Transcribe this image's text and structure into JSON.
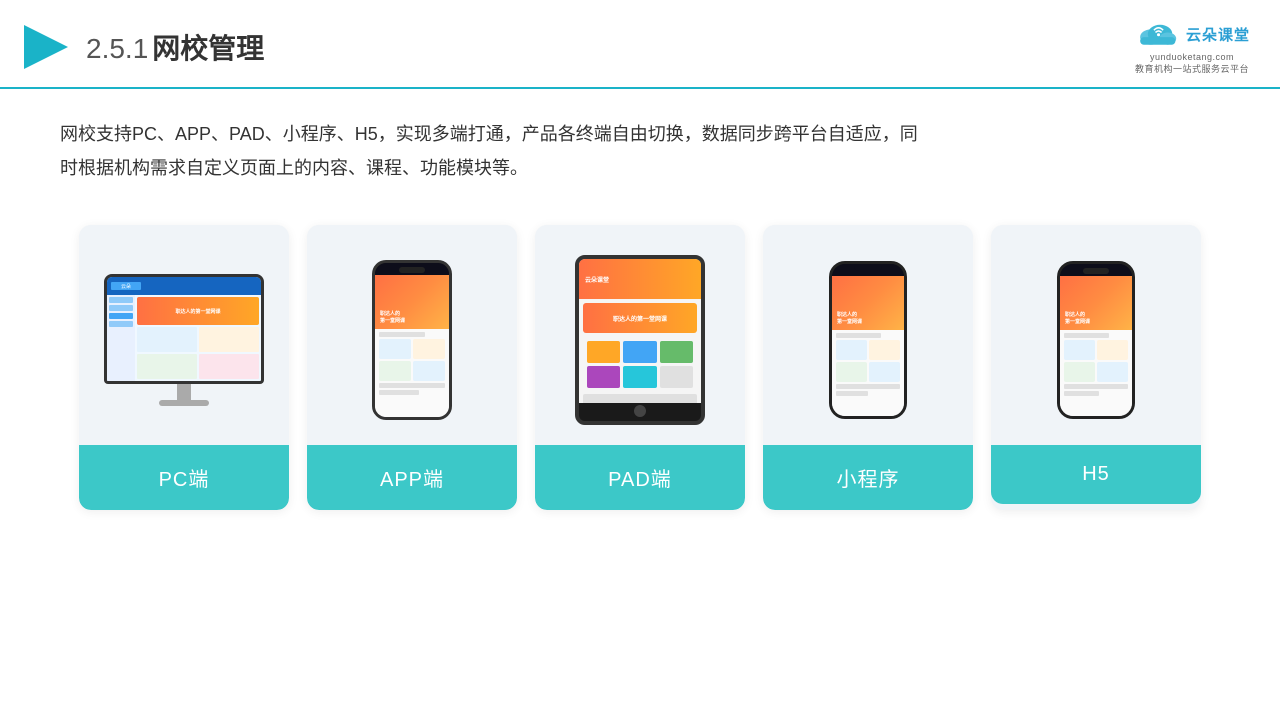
{
  "header": {
    "section_number": "2.5.1",
    "title": "网校管理",
    "logo_name": "云朵课堂",
    "logo_url": "yunduoketang.com",
    "logo_tagline": "教育机构一站式服务云平台"
  },
  "description": {
    "text": "网校支持PC、APP、PAD、小程序、H5，实现多端打通，产品各终端自由切换，数据同步跨平台自适应，同时根据机构需求自定义页面上的内容、课程、功能模块等。"
  },
  "cards": [
    {
      "id": "pc",
      "label": "PC端"
    },
    {
      "id": "app",
      "label": "APP端"
    },
    {
      "id": "pad",
      "label": "PAD端"
    },
    {
      "id": "miniprogram",
      "label": "小程序"
    },
    {
      "id": "h5",
      "label": "H5"
    }
  ],
  "colors": {
    "accent": "#3cc8c8",
    "header_border": "#1ab3c8",
    "card_bg": "#f0f4f8",
    "text_primary": "#333333"
  }
}
